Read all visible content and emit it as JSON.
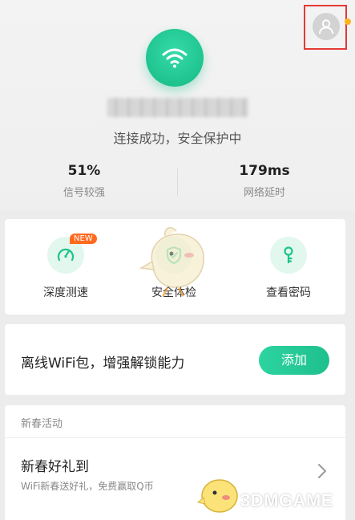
{
  "connection": {
    "status_text": "连接成功，安全保护中",
    "signal_value": "51%",
    "signal_label": "信号较强",
    "latency_value": "179ms",
    "latency_label": "网络延时"
  },
  "tools": [
    {
      "label": "深度测速",
      "icon": "speedometer-icon",
      "badge": "NEW"
    },
    {
      "label": "安全体检",
      "icon": "shield-check-icon"
    },
    {
      "label": "查看密码",
      "icon": "key-icon"
    }
  ],
  "offline": {
    "text": "离线WiFi包，增强解锁能力",
    "button_label": "添加"
  },
  "event": {
    "header": "新春活动",
    "title": "新春好礼到",
    "subtitle": "WiFi新春送好礼，免费赢取Q币"
  },
  "watermark": {
    "text": "3DMGAME"
  },
  "colors": {
    "accent": "#1fc38e",
    "badge": "#ff6a1f",
    "highlight_border": "#e53935",
    "notification_dot": "#ffb41f"
  }
}
